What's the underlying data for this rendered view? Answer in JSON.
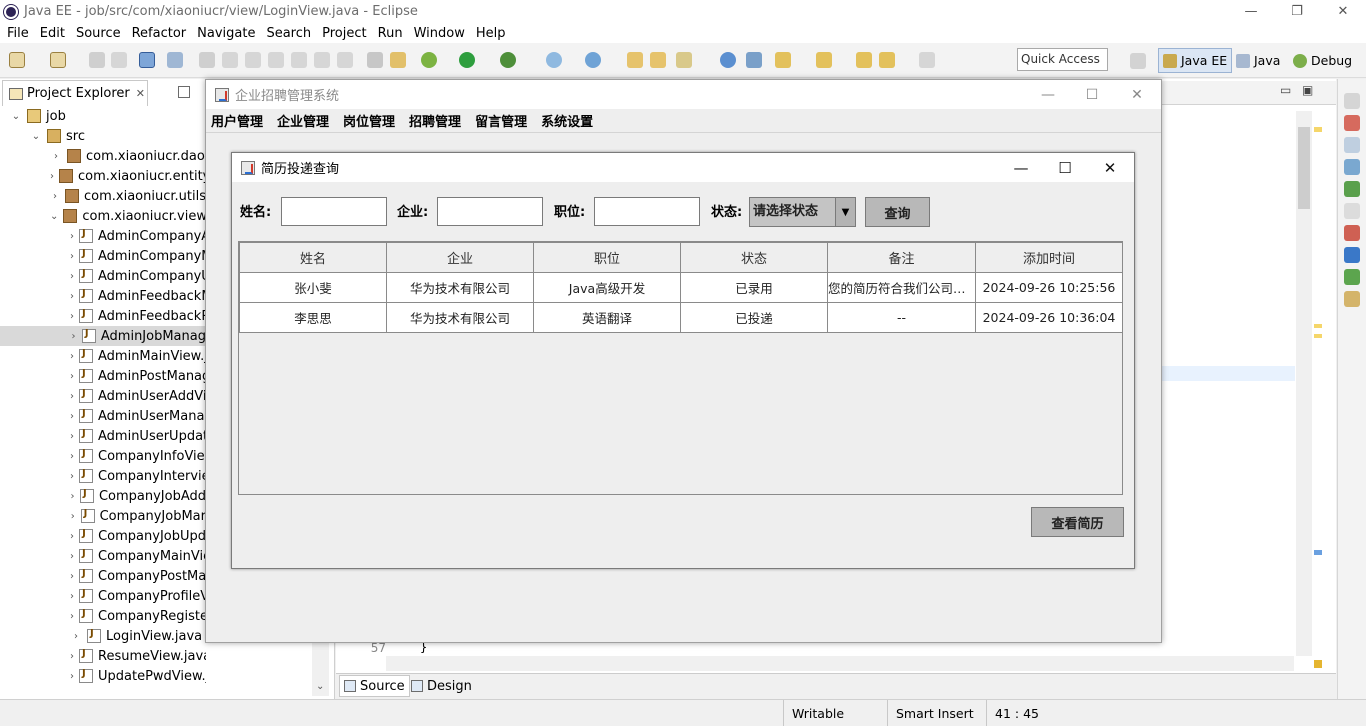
{
  "eclipse": {
    "title": "Java EE - job/src/com/xiaoniucr/view/LoginView.java - Eclipse",
    "menu": [
      "File",
      "Edit",
      "Source",
      "Refactor",
      "Navigate",
      "Search",
      "Project",
      "Run",
      "Window",
      "Help"
    ],
    "quick_access": "Quick Access",
    "perspectives": [
      "Java EE",
      "Java",
      "Debug"
    ],
    "project_explorer_tab": "Project Explorer",
    "tree": [
      {
        "label": "job",
        "level": 0,
        "kind": "proj",
        "exp": "⌄"
      },
      {
        "label": "src",
        "level": 1,
        "kind": "src",
        "exp": "⌄"
      },
      {
        "label": "com.xiaoniucr.dao",
        "level": 2,
        "kind": "pkg",
        "exp": "›"
      },
      {
        "label": "com.xiaoniucr.entity",
        "level": 2,
        "kind": "pkg",
        "exp": "›"
      },
      {
        "label": "com.xiaoniucr.utils",
        "level": 2,
        "kind": "pkg",
        "exp": "›"
      },
      {
        "label": "com.xiaoniucr.view",
        "level": 2,
        "kind": "pkg",
        "exp": "⌄"
      },
      {
        "label": "AdminCompanyA",
        "level": 3,
        "kind": "jfile",
        "exp": "›"
      },
      {
        "label": "AdminCompanyM",
        "level": 3,
        "kind": "jfile",
        "exp": "›"
      },
      {
        "label": "AdminCompanyU",
        "level": 3,
        "kind": "jfile",
        "exp": "›"
      },
      {
        "label": "AdminFeedbackM",
        "level": 3,
        "kind": "jfile",
        "exp": "›"
      },
      {
        "label": "AdminFeedbackR",
        "level": 3,
        "kind": "jfile",
        "exp": "›"
      },
      {
        "label": "AdminJobManag",
        "level": 3,
        "kind": "jfile",
        "exp": "›",
        "sel": true
      },
      {
        "label": "AdminMainView.j",
        "level": 3,
        "kind": "jfile",
        "exp": "›"
      },
      {
        "label": "AdminPostManag",
        "level": 3,
        "kind": "jfile",
        "exp": "›"
      },
      {
        "label": "AdminUserAddVi",
        "level": 3,
        "kind": "jfile",
        "exp": "›"
      },
      {
        "label": "AdminUserManag",
        "level": 3,
        "kind": "jfile",
        "exp": "›"
      },
      {
        "label": "AdminUserUpdat",
        "level": 3,
        "kind": "jfile",
        "exp": "›"
      },
      {
        "label": "CompanyInfoView",
        "level": 3,
        "kind": "jfile",
        "exp": "›"
      },
      {
        "label": "CompanyIntervie",
        "level": 3,
        "kind": "jfile",
        "exp": "›"
      },
      {
        "label": "CompanyJobAdd",
        "level": 3,
        "kind": "jfile",
        "exp": "›"
      },
      {
        "label": "CompanyJobMar",
        "level": 3,
        "kind": "jfile",
        "exp": "›"
      },
      {
        "label": "CompanyJobUpd",
        "level": 3,
        "kind": "jfile",
        "exp": "›"
      },
      {
        "label": "CompanyMainVie",
        "level": 3,
        "kind": "jfile",
        "exp": "›"
      },
      {
        "label": "CompanyPostMa",
        "level": 3,
        "kind": "jfile",
        "exp": "›"
      },
      {
        "label": "CompanyProfileV",
        "level": 3,
        "kind": "jfile",
        "exp": "›"
      },
      {
        "label": "CompanyRegister",
        "level": 3,
        "kind": "jfile",
        "exp": "›"
      },
      {
        "label": "LoginView.java",
        "level": 3,
        "kind": "jfile",
        "exp": "›"
      },
      {
        "label": "ResumeView.java",
        "level": 3,
        "kind": "jfile",
        "exp": "›"
      },
      {
        "label": "UpdatePwdView.java",
        "level": 3,
        "kind": "jfile",
        "exp": "›"
      }
    ],
    "editor_line_no": "57",
    "editor_line_text": "}",
    "bottom_tabs": [
      "Source",
      "Design"
    ],
    "status": {
      "writable": "Writable",
      "insert": "Smart Insert",
      "pos": "41 : 45"
    }
  },
  "mainframe": {
    "title": "企业招聘管理系统",
    "menu": [
      "用户管理",
      "企业管理",
      "岗位管理",
      "招聘管理",
      "留言管理",
      "系统设置"
    ]
  },
  "dialog": {
    "title": "简历投递查询",
    "labels": {
      "name": "姓名:",
      "company": "企业:",
      "job": "职位:",
      "status": "状态:"
    },
    "inputs": {
      "name": "",
      "company": "",
      "job": ""
    },
    "status_selected": "请选择状态",
    "query_button": "查询",
    "view_resume_button": "查看简历",
    "table": {
      "columns": [
        "姓名",
        "企业",
        "职位",
        "状态",
        "备注",
        "添加时间"
      ],
      "rows": [
        [
          "张小斐",
          "华为技术有限公司",
          "Java高级开发",
          "已录用",
          "您的简历符合我们公司的...",
          "2024-09-26 10:25:56"
        ],
        [
          "李思思",
          "华为技术有限公司",
          "英语翻译",
          "已投递",
          "--",
          "2024-09-26 10:36:04"
        ]
      ]
    }
  }
}
